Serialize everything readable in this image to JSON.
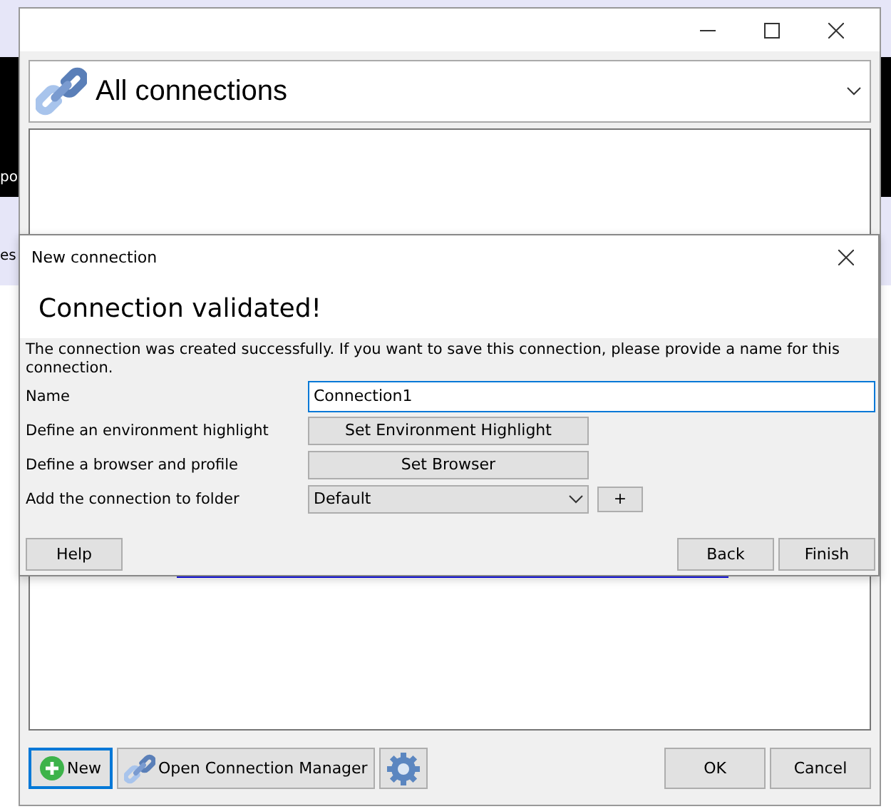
{
  "background_texts": [
    "po",
    "es"
  ],
  "main_window": {
    "connection_selector": {
      "value": "All connections"
    },
    "buttons": [
      {
        "label": "New",
        "kind": "new",
        "focused": true
      },
      {
        "label": "Open Connection Manager",
        "kind": "manager",
        "focused": false
      },
      {
        "kind": "settings",
        "focused": false
      }
    ],
    "dialog_buttons": [
      "OK",
      "Cancel"
    ]
  },
  "dialog": {
    "title": "New connection",
    "heading": "Connection validated!",
    "message": "The connection was created successfully. If you want to save this connection, please provide a name for this connection.",
    "rows": [
      {
        "label": "Name",
        "kind": "input",
        "value": "Connection1"
      },
      {
        "label": "Define an environment highlight",
        "kind": "button",
        "value": "Set Environment Highlight"
      },
      {
        "label": "Define a browser and profile",
        "kind": "button",
        "value": "Set Browser"
      },
      {
        "label": "Add the connection to folder",
        "kind": "select",
        "value": "Default",
        "extra": "+"
      }
    ],
    "buttons": [
      "Help",
      "Back",
      "Finish"
    ]
  }
}
